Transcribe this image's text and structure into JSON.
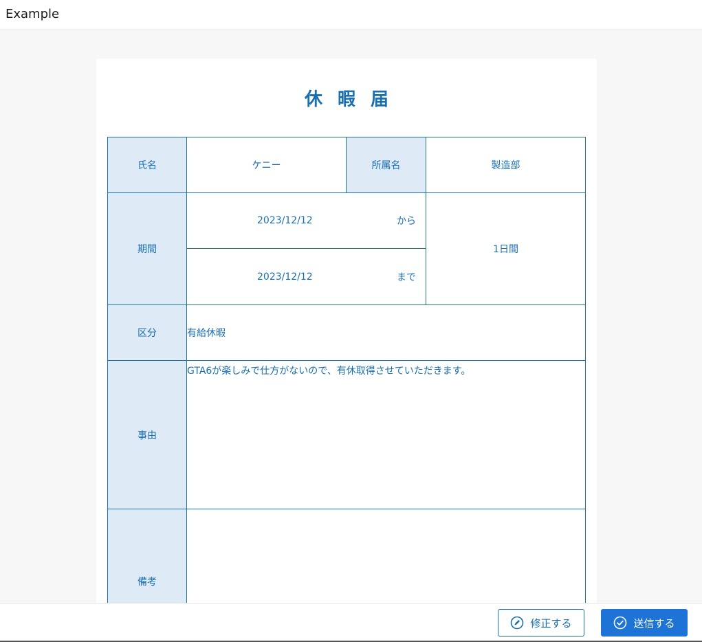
{
  "app": {
    "title": "Example"
  },
  "form": {
    "title": "休暇届",
    "fields": {
      "name_label": "氏名",
      "name_value": "ケニー",
      "dept_label": "所属名",
      "dept_value": "製造部",
      "period_label": "期間",
      "period_start": "2023/12/12",
      "period_start_suffix": "から",
      "period_end": "2023/12/12",
      "period_end_suffix": "まで",
      "period_days": "1日間",
      "category_label": "区分",
      "category_value": "有給休暇",
      "reason_label": "事由",
      "reason_value": "GTA6が楽しみで仕方がないので、有休取得させていただきます。",
      "remarks_label": "備考",
      "remarks_value": ""
    }
  },
  "footer": {
    "edit_label": "修正する",
    "send_label": "送信する"
  },
  "icons": {
    "edit": "pencil-circle-icon",
    "send": "check-circle-icon"
  },
  "colors": {
    "accent": "#1a6fb0",
    "label_bg": "#deeaf6",
    "primary_button": "#1d74d6"
  }
}
